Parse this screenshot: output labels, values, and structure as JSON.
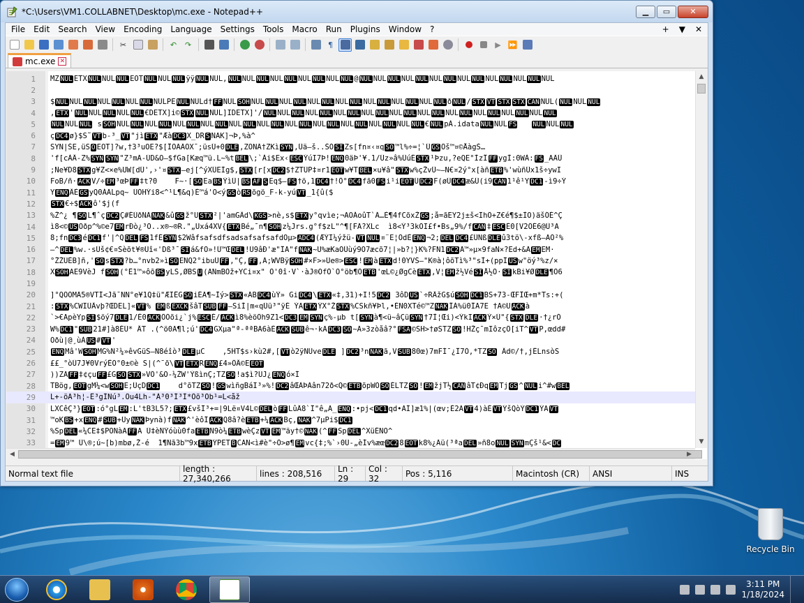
{
  "window": {
    "title": "*C:\\Users\\VM1.COLLABNET\\Desktop\\mc.exe - Notepad++"
  },
  "menu": [
    "File",
    "Edit",
    "Search",
    "View",
    "Encoding",
    "Language",
    "Settings",
    "Tools",
    "Macro",
    "Run",
    "Plugins",
    "Window",
    "?"
  ],
  "menu_right": [
    "+",
    "▼",
    "✕"
  ],
  "tab": {
    "label": "mc.exe"
  },
  "lines": [
    "MZ[NUL]ETX[NUL]NUL[NUL]EOT[NUL]NUL[NUL]ÿÿ[NUL]NUL,[NUL]NUL[NUL]NUL[NUL]NUL[NUL]NUL[NUL]@[NUL]NUL[NUL]NUL[NUL]NUL[NUL]NUL[NUL]NUL[NUL]NUL[NUL]NUL",
    "",
    "$[NUL]NUL[NUL]NUL[NUL]NUL[NUL]NULPE[NUL]NULd†[FF]NUL[SOH]NUL[NUL]NUL[NUL]NUL[NUL]NUL[NUL]NUL[NUL]NUL[NUL]NUL[NUL]ð[NUL]/[STX][VT][STX][STX][CAN]NUL([NUL]NUL[NUL]",
    ",[ETX]'[NUL]NUL[NUL]NUL[NUL]€DETX]i©[STX][NUL]NUL]IDETX]'/[NUL]NUL[NUL]NUL[NUL]NUL[NUL]NUL[NUL]NUL[NUL]NUL[NUL]NUL[NUL]NUL[NUL]NUL[NUL]NUL[NUL]",
    "[NUL]NUL[NUL] s[SOH]NUL[NUL]NUL[NUL]NUL[NUL]NUL[NUL]NUL[NUL]NUL[NUL]NUL[NUL]NUL[NUL]NUL[NUL]NUL[NUL]NUL[NUL]€[NUL]pÀ.idata[NUL]NUL[FS]   [NUL]NUL[NUL]",
    "ç[DC4]ø}$S˜[VT]b-³_[VT]\"jì[ETX]\"Æà[DC3]X_DR[S]NAK]¬Þ,%à^",
    "SYN|ŠE,üS[O]EOT]?w,†3³uOE?$[ÎÕÃÄÕX¯;üsÚ+0[DLE],ZÕNÄ†ZKì[SYN],Ûä—š..ŠÓ[SI]Zs[fn¤‹¤q[SO]™l%÷=¦`Û[GS]Ôš™¤©ÅàgŠ…",
    "'f[cÀÂ-Z%[SYN][SYN]\"Z³mÃ-ÚD&O—$fGa[Kæq™ü.L~%t[BEL]\\;`Ài$Ex‹[ESC]ÝúI7Þ![ENQ]0äÞ'¥.1/Üz»â%ÜúÉ[STX]¹Þzu,?eQE°ÌzÎ[FF]ygÌ:0WÀ:[FS]_AÄÛ",
    ";Ñe¥D8[STX]g¥Z<×e%UW[dÛ',›'¤[STX]—ej[^ýXÛEÌg$,[STX][r[x[DC2]$†ZTÜP‡¤r1[EOT]w¥T[BEL]×u¥â\"[STX]w%çŽvÛ~—N€¤2ý°x[àñ[ETB]%'wùñÜx1š÷ywI",
    "FoB/ñ·[ACK]V/÷[EM]³œÞ[FF]‡t?0    F~·[[SO]Ea[BS]ÝìÜ|[BS][AF][S]Eq$—[FS]†ö,1[DC4]†!Ô°[DC4]fã0[FS]i¹i[EOT]Ü[DC2]F(øÜ[DC4]æ&Ü(i9[CAN]1¹ê¹Y[DC1]-ì9÷Ý",
    "Y[ENQ]ÂÈ[GS]yQ0ÁÃLpq~ ÜÓHÝi8<^¹L¶&q)È™á'O<ý[GS]ò[RS]õgö_F-k-yú[VT]_1{û($",
    "[STX]€÷$[ACK]ô'$j(f",
    "%Ž^¿ ¶[SO]L¶ˆç[DC2]Ç#ÉÙðÑÃ[NAK]&û[GS]ž°U[STX]²|'amGÂd\\[KGS]>nè,s$[ETX]y°qvìe;¬AOÁoûT`Ä…È¶4fCõxŽ[GS];å=ãEY2j±š<ÏhÖ+Z€é¶$±ÌO)äšÓÉ^Ç",
    "ì8<©[US]Õðp^%©e7[EM]rÐò¿³Õ..x®~®R.\"„Ûxá4XV{[ETX]Bé„¯n¶[SOH]z¼Jrs.g°f$zL\"^¶[FÃ?XLc  ì8<Ý³3kÒI£f•Bs„9%/f[CAN]‡[ESC]É0[V2ÔÉ6@Ù³A",
    "8;fn[DC3]é[DC1]f'|^Q[DEL][FS]1fÉ[SYN]$2WâfsafsdfsadsafsafsafdÕµ>[ADC4](ÆÝÏ¼ýžü-[VT][NUL]¤¨E¦ÔdÉ[ENQ]¬2;[DEL][DC4]£ÛÑß[DLE]û3tö\\-xfß—AÓ²%",
    "–^[DEL]%w.·sÜš¢€¤Šèõt¥®Üî«'Dß³¯[SI]á&fÕ»!Ú™Œ[DEL]!Ù9âÐ'æ\"ÎÃ\"f[NAK]~U%æKaÓÛùý9O7æcõ7¦|»b?¦}K%?FÑ1[DC2]Ä™»µ×9faÑ×?Ed+&Ä[EM]EM·",
    "°ŽŽÚÈB]ñ,'[SO]s[STX]?b…°nvb2»ì[SO]ENQ2°ibuÜ[FF],\"Ç,[FF],Ã;WVBÿ[SOH]#×F>»Üe®>[ESC]![EM]à[ETX]d!0YVŠ—\"K®à¦ôõTì%³\"sÌ+(ppÎ[US]w\"öý³%z/×",
    "X[SOH]AE9VèJ f[SOH](°Ê1™»ôõ[BS]yLS,ØBS[U](ÃÑmBÖž+YCi¤x\" Ö'0î·V`·àJ®OfÔ`Ö°öb¶Ô[ETB]'œL©¿ØgCè[ETX],V¦[EM]ž½Vé[SI]Å½Ö·[SI]kBi¥Ø[DLE]¶Ö6",
    "",
    "]°QÕÕMÄ5®VTÍ<Jã¯NN°e¥1Q‡ü\"ÆÏÊG[SO]iÉÃ¶~Ìý>[STX]«ÄB[DC4]ùÝ» Gi[DC4]\\[ETX]«‡,31)+I!5[DC2] 3ôD[US]`÷RÂžG$ú[SOH][DC1]BS+73-ŒFÎŒ+m*Ts:+(",
    ":[STX]%CWÏÜÂvþ?ŒDEL]«[VT]% [EM]ß[EXCK]šâT[SUB][FF]—SiÍ|m«qÜü³\"ÿÉ ÝÃ[ETX]ÝX°Ž[STX]%CSkñ¥Þl,•ÉN0XTé©™Z[NAK]ÎÀ%ü0ÎÃ7E †A©U[ACK]à",
    "`>€ApèYp[SI]$öý7[DLE]1/È0[ACK]ÖÓõi¿`j%[ESC]É/[ACK]ì8%èöÖh9Z1<[DC3][EM][SYN]ç%-µb t[[SYN]à¶<ü~âÇü[SYN]†7Ì¦Œi)<ÝkI[ACK]Ý×Ü\"{[STX][DLE]·†¿rÓ",
    "W%[DC1]\"[SUB]21#]à8ÉÜ* ÂT .(^ö0Ã¶l;ú'[DC4]GXµa\"ª-ªªBÃ6àÈ[ACK][SUB]ê¬·kÃ[DC3][SO]~Ä»3zòåâ?°[FSA]©SH>†øSTZ[SO]!HŽç¯mIôzçÔ[iT^[VT]P,œdd#",
    "Õðù|@¸ùÀ[US]#[VT]'",
    "[ENQ]Mâ'W[SOH]MG%Ñ²¼»êvGüS—Ñ8éîò³[DLE]µC    ,5HT$s›kù2#,[[VT]ò2ÿNÜve[DLE] ][DC2]³n[NAK]ã,V[SUB]80œ)7mFÍ¯¿Î7Ò,*TZ[SO] Âd©/†,jÊLnsòS",
    "££_°òÜ7J¥0VrýÊÕ°0±©è S|(^¯õ\\[VT][ETX]R[ENQ]£4»ÔÂ©E[EOT]",
    "))ZÃ[FF]‡¢çu[FF]£G[SO][STX]»VÖ'&Õ-¼ŽW'ÝßìnÇ;TZ[SO]!a$ì?ÜJ¿[ENQ]ó×Í",
    "TBög,[EOT]gM¼<w[SOH]E;ÜçD[DC1]    d°õTZ[SO]![GS]wìñgBáÏ³»%![DC2]âŒÄÞÃân72ð<Q©[ETB]õpWÒ[SO]ÉLTZ[SO]![EM]žjT½[CAN]âT¢Ðq[EM]Tj[GS]^[NUL]i^#w[BEL]",
    "L+-öÃ³h¦-Ê³gÍNú³.Ôu4Lh-\"À³0³Í³Ì*Öõ³Õb¹=L<åž",
    "LXCêÇ³}[EOT]:ó°gL[EM]:L'tB3L5?;[ETX]£všÎ³+=|9Lë¤V4L©[DEL]ò[FF]LûÂ8`Î\"ê„Ã_[ENQ]:•pj<[DC1]qd•ÃÍ]æ1%|(œv;È2Ã[VT]4)àÈ[VT]ÝšQòÝ[DC1]ÝA[VT]",
    "™oK[BS]+x[ENQ]#[SUB]+Üy[NAK]Þynà)f[NAK]^'èôÎ[ACK]Q8â?è[ETB]+¼[ACK]Bç,[NAK]^7µPi$[DC1]",
    "%Sp[DEL]«¼CE‡$PONàÃ[FF]A Ù‡èÑÝóùù0fa[ETB]Ñ9ò¼[ETB]wèÇz[VT][EM]™äy†©[NAK](^[FF]Sp[DEL]^XüÉNO^",
    "=[EM]9™ Ü\\®;ú~[b)mbø,Ž-é  1¶Ñã3b™9x[ETB]ÝPET[B]CAN<ì#è\"÷Ô>ø¶[EM]vc{‡;%`›0Ü-„èÍv%æœ[DC2]8[EOT]k8%¿Äü(³ªa[DEL]»ñ8o[NUL][SYN]mÇš¹&<[DC]",
    "tK9Ûf[SOH]`Ê¼(/mg2&`[NUL]`{-m[ETB]iB©œl[IÕ.|[BS]'k(6xUžÃ^zßY[EM]è™![BS]"
  ],
  "current_line": 29,
  "status": {
    "filetype": "Normal text file",
    "length": "length : 27,340,266",
    "lines": "lines : 208,516",
    "ln": "Ln : 29",
    "col": "Col : 32",
    "pos": "Pos : 5,116",
    "eol": "Macintosh (CR)",
    "encoding": "ANSI",
    "mode": "INS"
  },
  "desktop": {
    "recycle_bin": "Recycle Bin"
  },
  "taskbar": {
    "time": "3:11 PM",
    "date": "1/18/2024"
  },
  "colors": {
    "tab_accent": "#f0a040",
    "token_bg": "#000000",
    "token_fg": "#ffffff"
  },
  "icons": [
    "notepadpp-icon",
    "minimize-icon",
    "maximize-icon",
    "close-icon",
    "save-disk-icon",
    "start-orb-icon",
    "ie-icon",
    "explorer-folder-icon",
    "media-player-icon",
    "chrome-icon",
    "notepadpp-taskbar-icon",
    "recycle-bin-icon"
  ]
}
